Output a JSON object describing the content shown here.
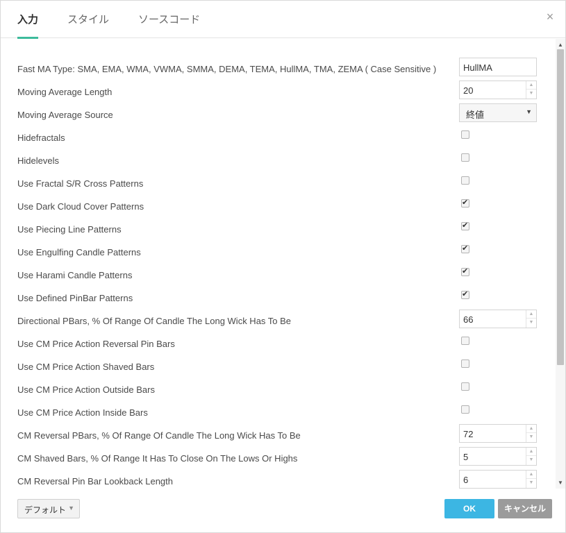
{
  "tabs": [
    {
      "label": "入力",
      "active": true
    },
    {
      "label": "スタイル",
      "active": false
    },
    {
      "label": "ソースコード",
      "active": false
    }
  ],
  "close_icon": "close-icon",
  "settings": [
    {
      "label": "Fast MA Type: SMA, EMA, WMA, VWMA, SMMA, DEMA, TEMA, HullMA, TMA, ZEMA ( Case Sensitive )",
      "control": "text",
      "value": "HullMA"
    },
    {
      "label": "Moving Average Length",
      "control": "number",
      "value": "20"
    },
    {
      "label": "Moving Average Source",
      "control": "select",
      "value": "終値"
    },
    {
      "label": "Hidefractals",
      "control": "checkbox",
      "checked": false
    },
    {
      "label": "Hidelevels",
      "control": "checkbox",
      "checked": false
    },
    {
      "label": "Use Fractal S/R Cross Patterns",
      "control": "checkbox",
      "checked": false
    },
    {
      "label": "Use Dark Cloud Cover Patterns",
      "control": "checkbox",
      "checked": true
    },
    {
      "label": "Use Piecing Line Patterns",
      "control": "checkbox",
      "checked": true
    },
    {
      "label": "Use Engulfing Candle Patterns",
      "control": "checkbox",
      "checked": true
    },
    {
      "label": "Use Harami Candle Patterns",
      "control": "checkbox",
      "checked": true
    },
    {
      "label": "Use Defined PinBar Patterns",
      "control": "checkbox",
      "checked": true
    },
    {
      "label": "Directional PBars, % Of Range Of Candle The Long Wick Has To Be",
      "control": "number",
      "value": "66"
    },
    {
      "label": "Use CM Price Action Reversal Pin Bars",
      "control": "checkbox",
      "checked": false
    },
    {
      "label": "Use CM Price Action Shaved Bars",
      "control": "checkbox",
      "checked": false
    },
    {
      "label": "Use CM Price Action Outside Bars",
      "control": "checkbox",
      "checked": false
    },
    {
      "label": "Use CM Price Action Inside Bars",
      "control": "checkbox",
      "checked": false
    },
    {
      "label": "CM Reversal PBars, % Of Range Of Candle The Long Wick Has To Be",
      "control": "number",
      "value": "72"
    },
    {
      "label": "CM Shaved Bars, % Of Range It Has To Close On The Lows Or Highs",
      "control": "number",
      "value": "5"
    },
    {
      "label": "CM Reversal Pin Bar Lookback Length",
      "control": "number",
      "value": "6"
    }
  ],
  "footer": {
    "default_label": "デフォルト",
    "ok_label": "OK",
    "cancel_label": "キャンセル"
  },
  "colors": {
    "accent_tab": "#3dbb9c",
    "ok_button": "#3cb6e3",
    "cancel_button": "#9b9b9b"
  }
}
